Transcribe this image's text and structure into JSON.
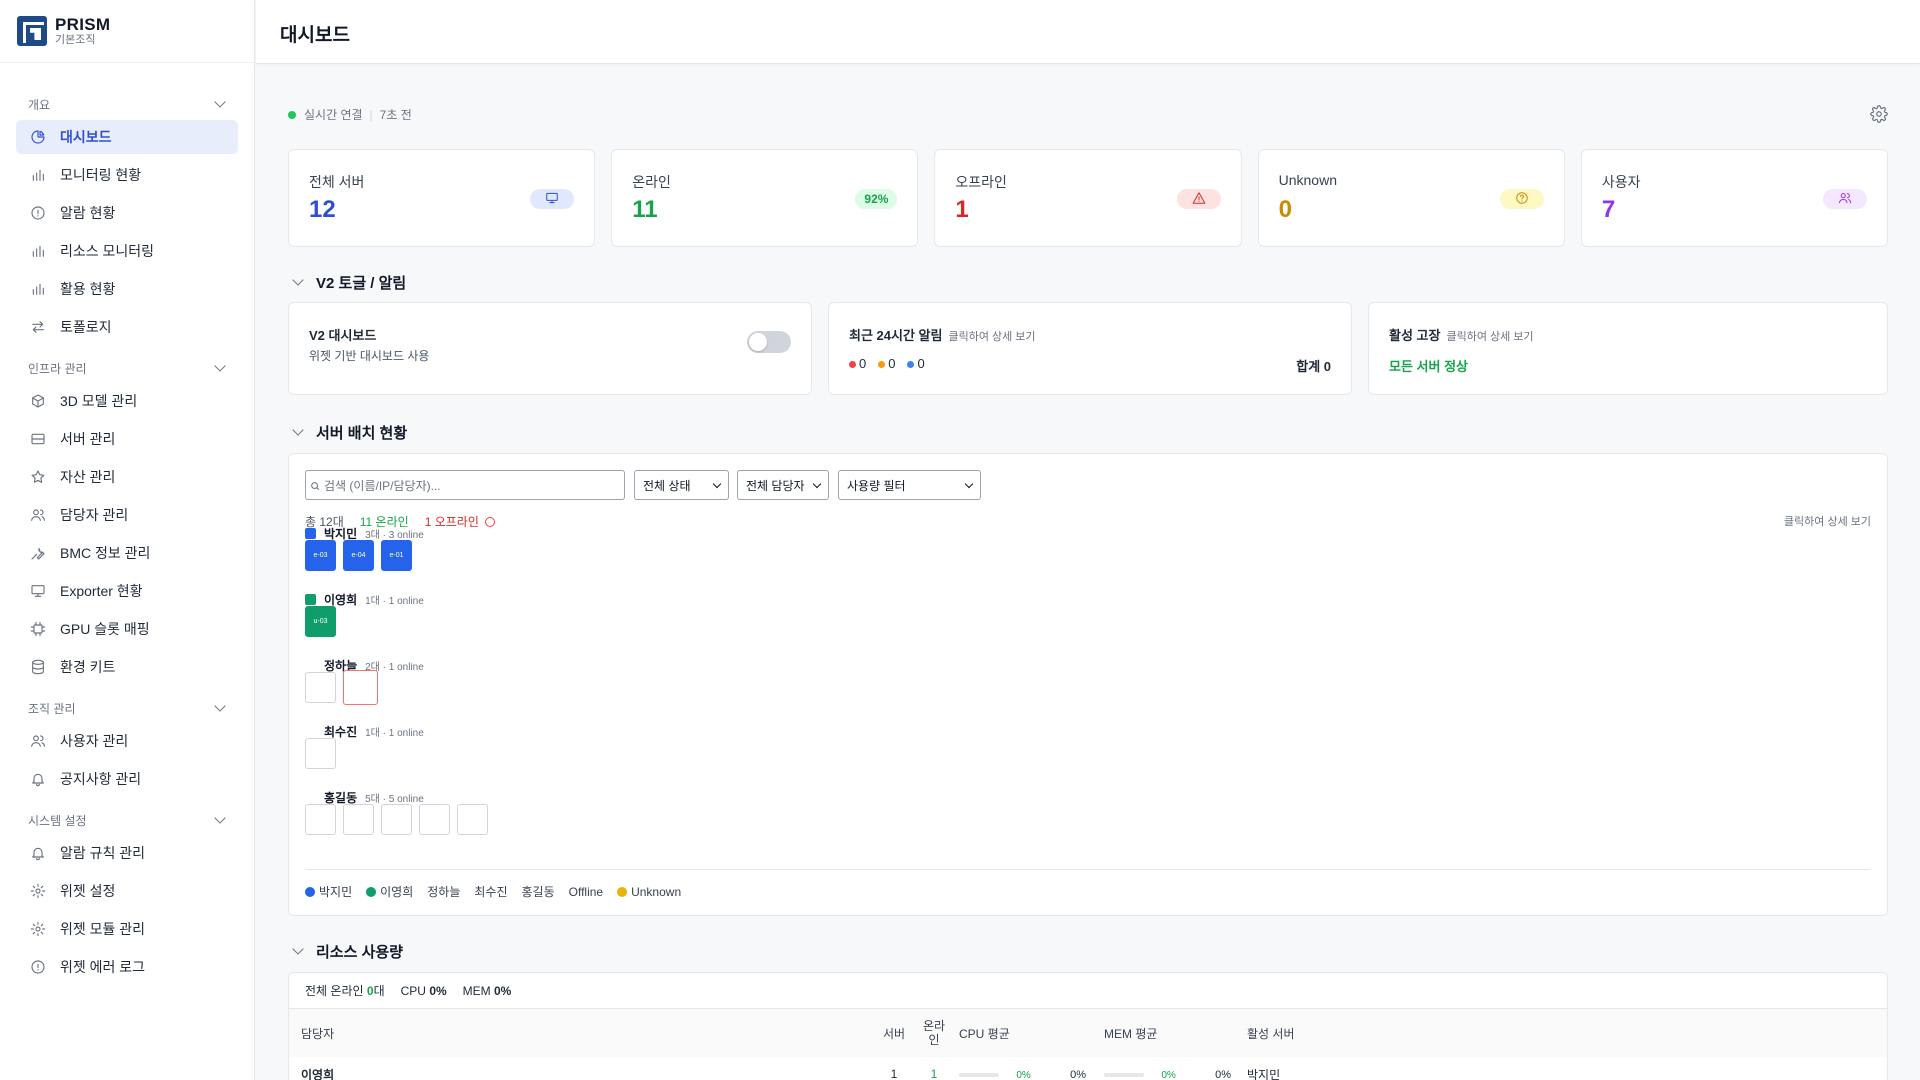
{
  "brand": {
    "name": "PRISM",
    "sub": "기본조직"
  },
  "sidebar": {
    "groups": [
      {
        "label": "개요",
        "items": [
          {
            "label": "대시보드",
            "icon": "pie-chart-icon",
            "active": true
          },
          {
            "label": "모니터링 현황",
            "icon": "bar-chart-icon"
          },
          {
            "label": "알람 현황",
            "icon": "alert-circle-icon"
          },
          {
            "label": "리소스 모니터링",
            "icon": "bar-chart-icon"
          },
          {
            "label": "활용 현황",
            "icon": "bar-chart-icon"
          },
          {
            "label": "토폴로지",
            "icon": "swap-arrows-icon"
          }
        ]
      },
      {
        "label": "인프라 관리",
        "items": [
          {
            "label": "3D 모델 관리",
            "icon": "cube-icon"
          },
          {
            "label": "서버 관리",
            "icon": "server-icon"
          },
          {
            "label": "자산 관리",
            "icon": "star-icon"
          },
          {
            "label": "담당자 관리",
            "icon": "users-icon"
          },
          {
            "label": "BMC 정보 관리",
            "icon": "wrench-icon"
          },
          {
            "label": "Exporter 현황",
            "icon": "presentation-icon"
          },
          {
            "label": "GPU 슬롯 매핑",
            "icon": "chip-icon"
          },
          {
            "label": "환경 키트",
            "icon": "database-icon"
          }
        ]
      },
      {
        "label": "조직 관리",
        "items": [
          {
            "label": "사용자 관리",
            "icon": "users-icon"
          },
          {
            "label": "공지사항 관리",
            "icon": "bell-icon"
          }
        ]
      },
      {
        "label": "시스템 설정",
        "items": [
          {
            "label": "알람 규칙 관리",
            "icon": "bell-icon"
          },
          {
            "label": "위젯 설정",
            "icon": "gear-icon"
          },
          {
            "label": "위젯 모듈 관리",
            "icon": "gear-icon"
          },
          {
            "label": "위젯 에러 로그",
            "icon": "alert-circle-icon"
          }
        ]
      }
    ]
  },
  "header": {
    "title": "대시보드"
  },
  "status": {
    "label": "실시간 연결",
    "sep": "|",
    "time": "7초 전"
  },
  "stats": [
    {
      "label": "전체 서버",
      "value": "12",
      "color": "#2f4fd1",
      "pill": "",
      "pill_bg": "#e0e7ff",
      "icon": "monitor-icon"
    },
    {
      "label": "온라인",
      "value": "11",
      "color": "#16a34a",
      "pill": "92%",
      "pill_bg": "#dcfce7",
      "icon": ""
    },
    {
      "label": "오프라인",
      "value": "1",
      "color": "#dc2626",
      "pill": "",
      "pill_bg": "#fee2e2",
      "icon": "warning-icon"
    },
    {
      "label": "Unknown",
      "value": "0",
      "color": "#ca8a04",
      "pill": "",
      "pill_bg": "#fef9c3",
      "icon": "question-icon"
    },
    {
      "label": "사용자",
      "value": "7",
      "color": "#9333ea",
      "pill": "",
      "pill_bg": "#f3e8ff",
      "icon": "users-icon"
    }
  ],
  "v2section": {
    "title": "V2 토글 / 알림"
  },
  "v2card": {
    "title": "V2 대시보드",
    "desc": "위젯 기반 대시보드 사용"
  },
  "alerts": {
    "title": "최근 24시간 알림",
    "hint": "클릭하여 상세 보기",
    "red": "0",
    "orange": "0",
    "blue": "0",
    "total_label": "합계 0"
  },
  "faults": {
    "title": "활성 고장",
    "hint": "클릭하여 상세 보기",
    "status": "모든 서버 정상"
  },
  "placement": {
    "title": "서버 배치 현황",
    "search_placeholder": "검색 (이름/IP/담당자)...",
    "filters": [
      "전체 상태",
      "전체 담당자",
      "사용량 필터"
    ],
    "total": "총 12대",
    "online": "11 온라인",
    "offline": "1 오프라인",
    "hint": "클릭하여 상세 보기",
    "owners": [
      {
        "name": "박지민",
        "meta": "3대 · 3 online",
        "color": "#2563eb",
        "tiles": [
          "e-03",
          "e-04",
          "e-01"
        ],
        "filled": true
      },
      {
        "name": "이영희",
        "meta": "1대 · 1 online",
        "color": "#0f9d6b",
        "tiles": [
          "u-03"
        ],
        "filled": true
      },
      {
        "name": "정하늘",
        "meta": "2대 · 1 online",
        "color": "",
        "tiles": [
          "",
          ""
        ],
        "filled": false
      },
      {
        "name": "최수진",
        "meta": "1대 · 1 online",
        "color": "",
        "tiles": [
          ""
        ],
        "filled": false
      },
      {
        "name": "홍길동",
        "meta": "5대 · 5 online",
        "color": "",
        "tiles": [
          "",
          "",
          "",
          "",
          ""
        ],
        "filled": false
      }
    ],
    "legend": [
      {
        "label": "박지민",
        "color": "#2563eb"
      },
      {
        "label": "이영희",
        "color": "#0f9d6b"
      },
      {
        "label": "정하늘",
        "color": ""
      },
      {
        "label": "최수진",
        "color": ""
      },
      {
        "label": "홍길동",
        "color": ""
      },
      {
        "label": "Offline",
        "color": ""
      },
      {
        "label": "Unknown",
        "color": "#eab308"
      }
    ]
  },
  "resources": {
    "title": "리소스 사용량",
    "summary_prefix": "전체 온라인",
    "summary_count": "0",
    "summary_unit": "대",
    "cpu_label": "CPU",
    "cpu": "0%",
    "mem_label": "MEM",
    "mem": "0%",
    "columns": [
      "담당자",
      "서버",
      "온라인",
      "CPU 평균",
      "MEM 평균",
      "활성 서버"
    ],
    "rows": [
      {
        "owner": "이영희",
        "servers": "1",
        "online": "1",
        "cpu": "0%",
        "cpu2": "0%",
        "mem": "0%",
        "mem2": "0%",
        "active": "박지민"
      }
    ]
  }
}
